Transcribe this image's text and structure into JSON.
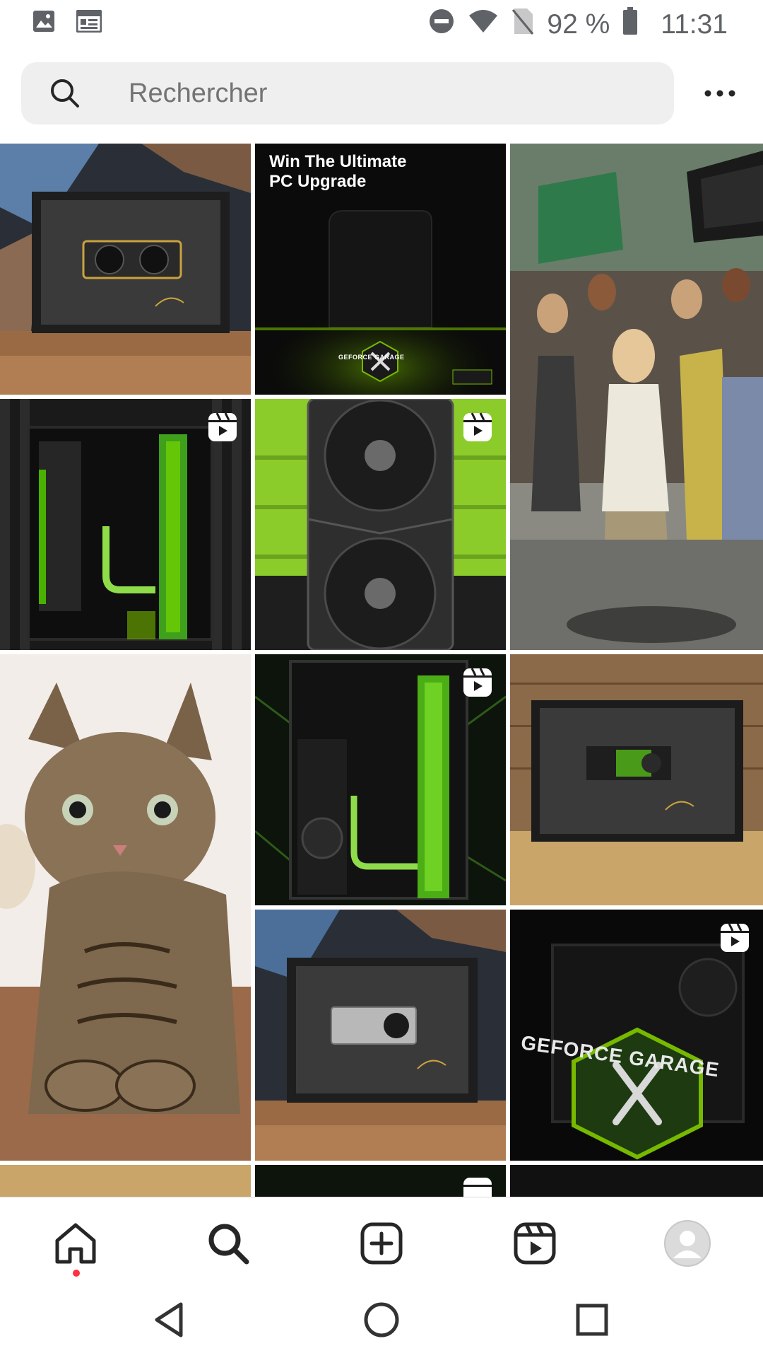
{
  "status_bar": {
    "left_icons": [
      "image-icon",
      "news-icon"
    ],
    "right_icons": [
      "do-not-disturb-icon",
      "wifi-icon",
      "no-sim-icon"
    ],
    "battery_text": "92 %",
    "time": "11:31"
  },
  "search": {
    "placeholder": "Rechercher",
    "more_icon": "more-horizontal-icon"
  },
  "grid": {
    "tiles": [
      {
        "name": "grid-tile-framed-gpu-2018",
        "reel": false
      },
      {
        "name": "grid-tile-win-pc-upgrade",
        "reel": false,
        "title_line1": "Win The Ultimate",
        "title_line2": "PC Upgrade",
        "badge": "GEFORCE GARAGE"
      },
      {
        "name": "grid-tile-protest-photo",
        "reel": false
      },
      {
        "name": "grid-tile-green-pc-build",
        "reel": true
      },
      {
        "name": "grid-tile-gpu-closeup",
        "reel": true
      },
      {
        "name": "grid-tile-cat-photo",
        "reel": false
      },
      {
        "name": "grid-tile-green-pc-build-2",
        "reel": true
      },
      {
        "name": "grid-tile-framed-gpu-2006",
        "reel": false
      },
      {
        "name": "grid-tile-framed-gpu-2017",
        "reel": false
      },
      {
        "name": "grid-tile-geforce-garage-logo",
        "reel": true,
        "logo_text": "GEFORCE GARAGE"
      }
    ]
  },
  "bottom_nav": {
    "items": [
      {
        "name": "nav-home",
        "icon": "home-icon",
        "has_notification_dot": true
      },
      {
        "name": "nav-search",
        "icon": "search-icon",
        "active": true
      },
      {
        "name": "nav-create",
        "icon": "add-square-icon"
      },
      {
        "name": "nav-reels",
        "icon": "reels-icon"
      },
      {
        "name": "nav-profile",
        "icon": "avatar"
      }
    ]
  },
  "android_nav": {
    "buttons": [
      "back-icon",
      "home-circle-icon",
      "recents-icon"
    ]
  },
  "colors": {
    "accent_green": "#76b900",
    "notification_red": "#ff3040",
    "search_bg": "#efefef"
  }
}
